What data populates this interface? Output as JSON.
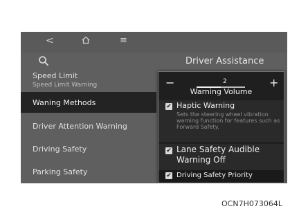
{
  "nav": {
    "back_icon": "back-chevron-icon",
    "home_icon": "home-icon",
    "menu_icon": "menu-icon",
    "back_glyph": "<",
    "menu_glyph": "≡"
  },
  "header": {
    "title": "Driver Assistance",
    "search_icon": "search-icon"
  },
  "sidebar": {
    "items": [
      {
        "label": "Speed Limit",
        "sub": "Speed Limit Warning"
      },
      {
        "label": "Waning Methods",
        "selected": true
      },
      {
        "label": "Driver Attention Warning"
      },
      {
        "label": "Driving Safety"
      },
      {
        "label": "Parking Safety"
      }
    ]
  },
  "popup": {
    "volume": {
      "minus": "−",
      "plus": "+",
      "value": "2",
      "level": 0.5,
      "label": "Warning Volume"
    },
    "options": [
      {
        "label": "Haptic Warning",
        "checked": true,
        "description": "Sets the steering wheel vibration warning function for features such as Forward Safety."
      },
      {
        "label": "Lane Safety Audible Warning Off",
        "checked": true
      },
      {
        "label": "Driving Safety Priority",
        "checked": true
      }
    ],
    "check_glyph": "✔"
  },
  "figure_code": "OCN7H073064L",
  "colors": {
    "screen_bg": "#5f5f5f",
    "selected_bg": "#232323",
    "popup_bg": "#1f1f1f",
    "text": "#f0f0f0"
  }
}
